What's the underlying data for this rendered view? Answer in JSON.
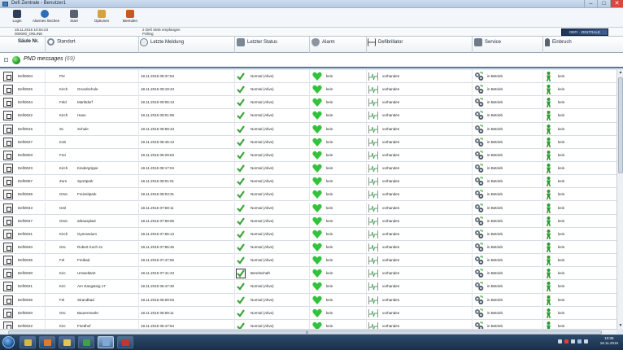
{
  "window": {
    "title": "Defi Zentrale - Benutzer1",
    "controls": [
      "–",
      "□",
      "✕"
    ]
  },
  "toolbar": [
    {
      "label": "Login",
      "icon": "login-icon",
      "color": "#2f3e55"
    },
    {
      "label": "Alarmes löschen",
      "icon": "refresh-icon",
      "color": "#2c6fb8"
    },
    {
      "label": "Start",
      "icon": "run-icon",
      "color": "#5a6270"
    },
    {
      "label": "Optionen",
      "icon": "options-icon",
      "color": "#d8a23a"
    },
    {
      "label": "Beenden",
      "icon": "exit-icon",
      "color": "#cc5520"
    }
  ],
  "status": {
    "line1": "18.11.2015 10:04:23",
    "line2": "000000_ONLINE",
    "msg1": "2 Defi SMS empfangen",
    "msg2": "Polling",
    "logo": "DEFI · ZENTRALE"
  },
  "columns": [
    {
      "label": "Säule Nr.",
      "icon": "",
      "bold": true
    },
    {
      "label": "Standort",
      "icon": "search-icon"
    },
    {
      "label": "Letzte Meldung",
      "icon": "clock-icon"
    },
    {
      "label": "Letzter Status",
      "icon": "gears-icon"
    },
    {
      "label": "Alarm",
      "icon": "heart-icon"
    },
    {
      "label": "Defibrillator",
      "icon": "ecg-icon"
    },
    {
      "label": "Service",
      "icon": "service-icon"
    },
    {
      "label": "Einbruch",
      "icon": "person-icon"
    }
  ],
  "group": {
    "title": "PND messages",
    "count": "(69)",
    "toggle": "−"
  },
  "rows": [
    {
      "id": "Defi0004",
      "c": "Pör",
      "loc": "",
      "ts": "18.11.2015 09:37:53",
      "status": "Normal (Alive)",
      "alarm": "kein",
      "defi": "vorhanden",
      "service": "in Betrieb",
      "einbruch": "kein"
    },
    {
      "id": "Defi0026",
      "c": "Kirch",
      "loc": "Grundschule",
      "ts": "18.11.2015 09:19:43",
      "status": "Normal (Alive)",
      "alarm": "kein",
      "defi": "vorhanden",
      "service": "in Betrieb",
      "einbruch": "kein"
    },
    {
      "id": "Defi0034",
      "c": "Feld",
      "loc": "Marktdorf",
      "ts": "18.11.2015 09:05:13",
      "status": "Normal (Alive)",
      "alarm": "kein",
      "defi": "vorhanden",
      "service": "in Betrieb",
      "einbruch": "kein"
    },
    {
      "id": "Defi0022",
      "c": "Kirch",
      "loc": "Haus",
      "ts": "18.11.2015 09:01:06",
      "status": "Normal (Alive)",
      "alarm": "kein",
      "defi": "vorhanden",
      "service": "in Betrieb",
      "einbruch": "kein"
    },
    {
      "id": "Defi0016",
      "c": "Sc",
      "loc": "Schule",
      "ts": "18.11.2015 08:59:43",
      "status": "Normal (Alive)",
      "alarm": "kein",
      "defi": "vorhanden",
      "service": "in Betrieb",
      "einbruch": "kein"
    },
    {
      "id": "Defi0027",
      "c": "Kob",
      "loc": "",
      "ts": "18.11.2015 08:45:13",
      "status": "Normal (Alive)",
      "alarm": "kein",
      "defi": "vorhanden",
      "service": "in Betrieb",
      "einbruch": "kein"
    },
    {
      "id": "Defi0003",
      "c": "Frei",
      "loc": "",
      "ts": "18.11.2015 08:29:53",
      "status": "Normal (Alive)",
      "alarm": "kein",
      "defi": "vorhanden",
      "service": "in Betrieb",
      "einbruch": "kein"
    },
    {
      "id": "Defi0023",
      "c": "Kirch",
      "loc": "Kindergrippe",
      "ts": "18.11.2015 08:17:04",
      "status": "Normal (Alive)",
      "alarm": "kein",
      "defi": "vorhanden",
      "service": "in Betrieb",
      "einbruch": "kein"
    },
    {
      "id": "Defi0057",
      "c": "Zorn",
      "loc": "Sportpark",
      "ts": "18.11.2015 08:01:01",
      "status": "Normal (Alive)",
      "alarm": "kein",
      "defi": "vorhanden",
      "service": "in Betrieb",
      "einbruch": "kein"
    },
    {
      "id": "Defi0039",
      "c": "Grün",
      "loc": "Freizeitpark",
      "ts": "18.11.2015 08:03:31",
      "status": "Normal (Alive)",
      "alarm": "kein",
      "defi": "vorhanden",
      "service": "in Betrieb",
      "einbruch": "kein"
    },
    {
      "id": "Defi0043",
      "c": "Isml",
      "loc": "",
      "ts": "18.11.2015 07:59:11",
      "status": "Normal (Alive)",
      "alarm": "kein",
      "defi": "vorhanden",
      "service": "in Betrieb",
      "einbruch": "kein"
    },
    {
      "id": "Defi0047",
      "c": "Grün",
      "loc": "athausplatz",
      "ts": "18.11.2015 07:59:06",
      "status": "Normal (Alive)",
      "alarm": "kein",
      "defi": "vorhanden",
      "service": "in Betrieb",
      "einbruch": "kein"
    },
    {
      "id": "Defi0031",
      "c": "Kirch",
      "loc": "Gymnasium",
      "ts": "18.11.2015 07:55:13",
      "status": "Normal (Alive)",
      "alarm": "kein",
      "defi": "vorhanden",
      "service": "in Betrieb",
      "einbruch": "kein"
    },
    {
      "id": "Defi0040",
      "c": "Grü",
      "loc": "Robert Koch 41",
      "ts": "18.11.2015 07:55:45",
      "status": "Normal (Alive)",
      "alarm": "kein",
      "defi": "vorhanden",
      "service": "in Betrieb",
      "einbruch": "kein"
    },
    {
      "id": "Defi0035",
      "c": "Fel",
      "loc": "Freibad",
      "ts": "18.11.2015 07:47:55",
      "status": "Normal (Alive)",
      "alarm": "kein",
      "defi": "vorhanden",
      "service": "in Betrieb",
      "einbruch": "kein"
    },
    {
      "id": "Defi0030",
      "c": "Kirc",
      "loc": "Umweltamt",
      "ts": "18.11.2015 07:41:43",
      "status": "Bereitschaft",
      "alarm": "kein",
      "defi": "vorhanden",
      "service": "in Betrieb",
      "einbruch": "kein",
      "boxed": true
    },
    {
      "id": "Defi0021",
      "c": "Kirc",
      "loc": "Am Gangsteig 17",
      "ts": "18.11.2015 06:47:30",
      "status": "Normal (Alive)",
      "alarm": "kein",
      "defi": "vorhanden",
      "service": "in Betrieb",
      "einbruch": "kein"
    },
    {
      "id": "Defi0036",
      "c": "Fel",
      "loc": "Strandbad",
      "ts": "18.11.2015 06:09:03",
      "status": "Normal (Alive)",
      "alarm": "kein",
      "defi": "vorhanden",
      "service": "in Betrieb",
      "einbruch": "kein"
    },
    {
      "id": "Defi0020",
      "c": "Grü",
      "loc": "Bauernmarkt",
      "ts": "18.11.2015 06:09:11",
      "status": "Normal (Alive)",
      "alarm": "kein",
      "defi": "vorhanden",
      "service": "in Betrieb",
      "einbruch": "kein"
    },
    {
      "id": "Defi0022",
      "c": "Kirc",
      "loc": "Friedhof",
      "ts": "18.11.2015 05:47:54",
      "status": "Normal (Alive)",
      "alarm": "kein",
      "defi": "vorhanden",
      "service": "in Betrieb",
      "einbruch": "kein"
    }
  ],
  "scrollbar": {
    "h_mid": "|||"
  },
  "taskbar": {
    "apps": [
      {
        "name": "explorer-taskbar-icon",
        "color": "#d9b54a"
      },
      {
        "name": "media-player-taskbar-icon",
        "color": "#e37a2a"
      },
      {
        "name": "folder-taskbar-icon",
        "color": "#e8c35a"
      },
      {
        "name": "chrome-taskbar-icon",
        "color": "#43a047"
      },
      {
        "name": "defi-taskbar-icon",
        "color": "#7ea8d6",
        "active": true
      },
      {
        "name": "app-taskbar-icon",
        "color": "#c0392b"
      }
    ],
    "time": "10:05",
    "date": "18.11.2015",
    "tray_colors": [
      "#cfd8e3",
      "#e04030",
      "#cfd8e3",
      "#9fc3e8",
      "#cfd8e3"
    ]
  },
  "colors": {
    "check": "#3aa53a",
    "heart": "#33c33a",
    "figure": "#2c9b37",
    "ecg": "#46a35a"
  }
}
